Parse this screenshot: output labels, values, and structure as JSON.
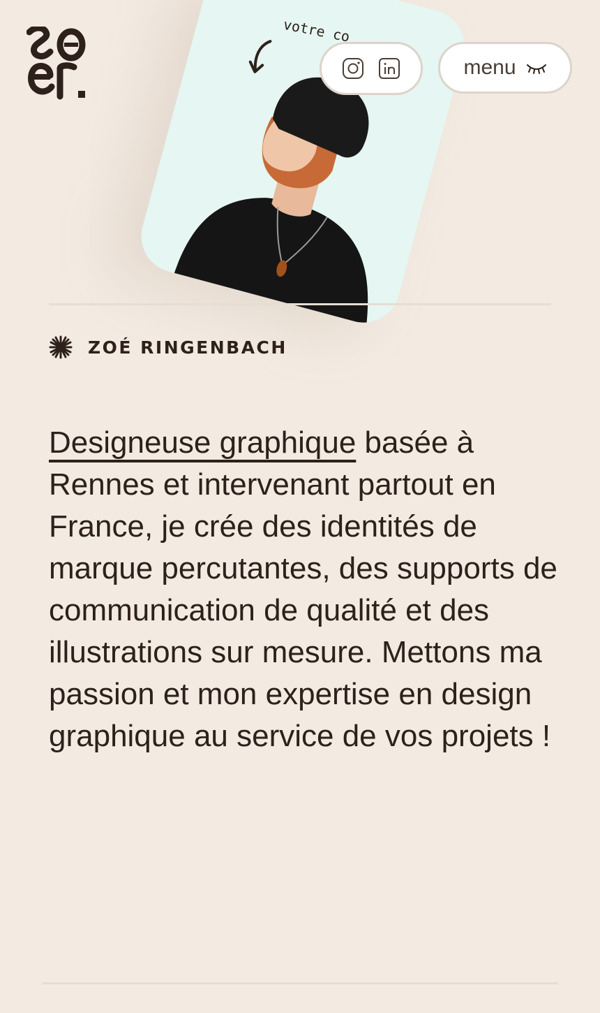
{
  "header": {
    "logo_alt": "zoer",
    "menu_label": "menu",
    "social": [
      {
        "name": "instagram",
        "icon": "instagram-icon"
      },
      {
        "name": "linkedin",
        "icon": "linkedin-icon"
      }
    ]
  },
  "hero": {
    "handwritten_text": "votre co",
    "person_name": "ZOÉ RINGENBACH"
  },
  "intro": {
    "highlight": "Designeuse graphique",
    "body": " basée à Rennes et intervenant partout en France, je crée des identités de marque percutantes, des supports de communication de qualité et des illustrations sur mesure. Mettons ma passion et mon expertise en design graphique au service de vos projets !"
  },
  "colors": {
    "background": "#f3ebe2",
    "text": "#2e211b",
    "card": "#e6f6f2",
    "pill_border": "#dcd4cb"
  }
}
